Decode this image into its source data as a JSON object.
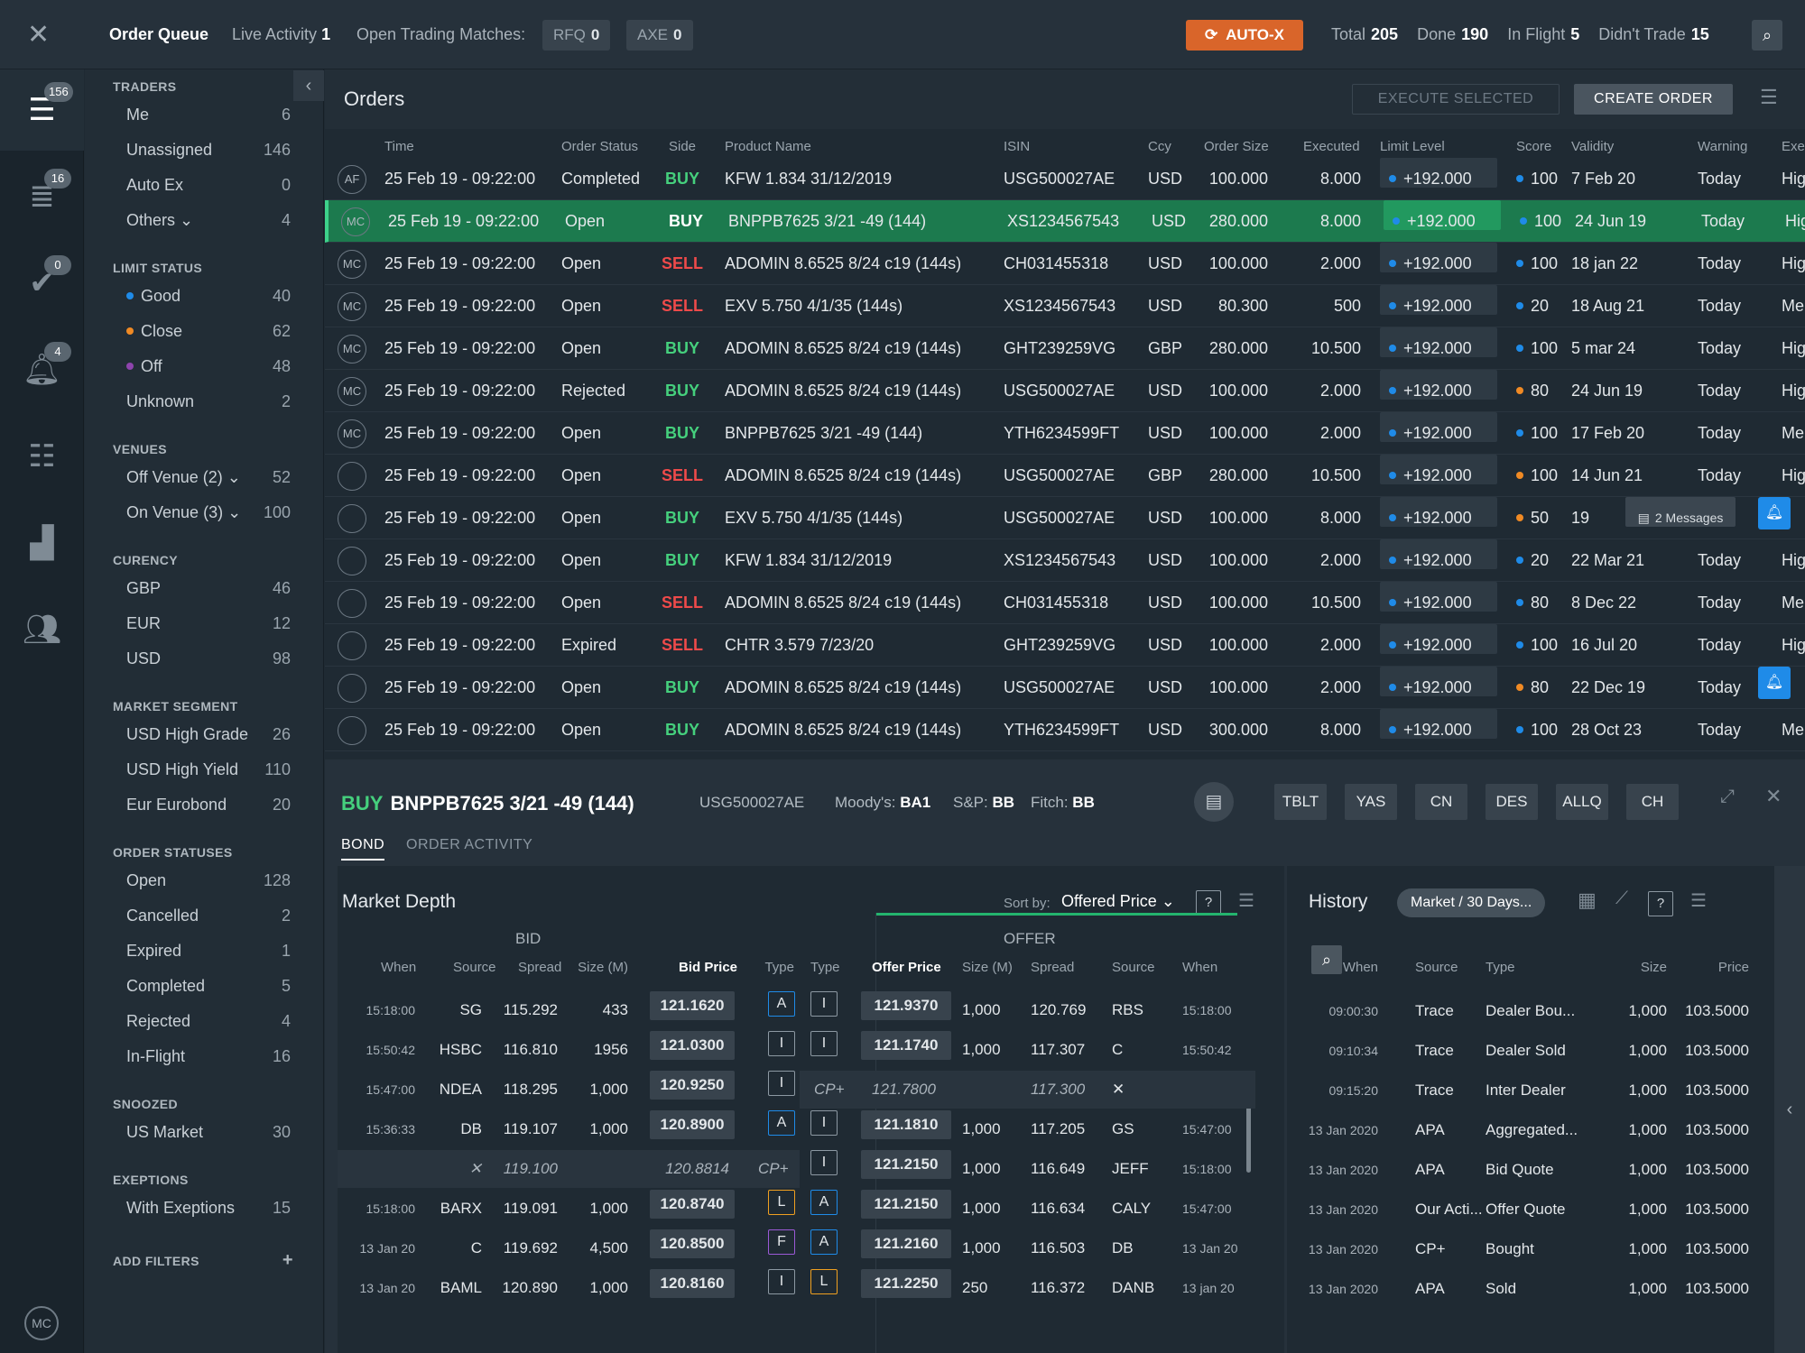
{
  "topbar": {
    "order_queue": "Order Queue",
    "live_activity_label": "Live Activity",
    "live_activity_count": "1",
    "open_matches_label": "Open Trading Matches:",
    "rfq_label": "RFQ",
    "rfq_count": "0",
    "axe_label": "AXE",
    "axe_count": "0",
    "autox": "AUTO-X",
    "total_label": "Total",
    "total": "205",
    "done_label": "Done",
    "done": "190",
    "inflight_label": "In Flight",
    "inflight": "5",
    "didnt_label": "Didn't Trade",
    "didnt": "15"
  },
  "leftnav": {
    "badges": [
      "156",
      "16",
      "0",
      "4"
    ],
    "avatar": "MC"
  },
  "filters": {
    "sections": [
      {
        "title": "TRADERS",
        "items": [
          {
            "label": "Me",
            "count": "6"
          },
          {
            "label": "Unassigned",
            "count": "146"
          },
          {
            "label": "Auto Ex",
            "count": "0"
          },
          {
            "label": "Others ⌄",
            "count": "4"
          }
        ]
      },
      {
        "title": "LIMIT STATUS",
        "items": [
          {
            "label": "Good",
            "count": "40",
            "dot": "#1f8be8"
          },
          {
            "label": "Close",
            "count": "62",
            "dot": "#f08a24"
          },
          {
            "label": "Off",
            "count": "48",
            "dot": "#8e44ad"
          },
          {
            "label": "Unknown",
            "count": "2"
          }
        ]
      },
      {
        "title": "VENUES",
        "items": [
          {
            "label": "Off Venue (2) ⌄",
            "count": "52"
          },
          {
            "label": "On Venue (3) ⌄",
            "count": "100"
          }
        ]
      },
      {
        "title": "CURENCY",
        "items": [
          {
            "label": "GBP",
            "count": "46"
          },
          {
            "label": "EUR",
            "count": "12"
          },
          {
            "label": "USD",
            "count": "98"
          }
        ]
      },
      {
        "title": "MARKET SEGMENT",
        "items": [
          {
            "label": "USD High Grade",
            "count": "26"
          },
          {
            "label": "USD High Yield",
            "count": "110"
          },
          {
            "label": "Eur Eurobond",
            "count": "20"
          }
        ]
      },
      {
        "title": "ORDER STATUSES",
        "items": [
          {
            "label": "Open",
            "count": "128"
          },
          {
            "label": "Cancelled",
            "count": "2"
          },
          {
            "label": "Expired",
            "count": "1"
          },
          {
            "label": "Completed",
            "count": "5"
          },
          {
            "label": "Rejected",
            "count": "4"
          },
          {
            "label": "In-Flight",
            "count": "16"
          }
        ]
      },
      {
        "title": "SNOOZED",
        "items": [
          {
            "label": "US Market",
            "count": "30"
          }
        ]
      },
      {
        "title": "EXEPTIONS",
        "items": [
          {
            "label": "With Exeptions",
            "count": "15"
          }
        ]
      }
    ],
    "add_filters": "ADD FILTERS"
  },
  "orders": {
    "title": "Orders",
    "execute_selected": "EXECUTE SELECTED",
    "create_order": "CREATE ORDER",
    "columns": [
      "Time",
      "Order Status",
      "Side",
      "Product Name",
      "ISIN",
      "Ccy",
      "Order Size",
      "Executed",
      "Limit Level",
      "Score",
      "Validity",
      "Warning",
      "Exe"
    ],
    "rows": [
      {
        "mark": "AF",
        "time": "25 Feb 19 - 09:22:00",
        "status": "Completed",
        "side": "BUY",
        "product": "KFW  1.834  31/12/2019",
        "isin": "USG500027AE",
        "ccy": "USD",
        "size": "100.000",
        "executed": "8.000",
        "limit": "+192.000",
        "score": "100",
        "score_color": "#1f8be8",
        "validity": "7 Feb 20",
        "warning": "Today",
        "exe": "Hig"
      },
      {
        "mark": "MC",
        "time": "25 Feb 19 - 09:22:00",
        "status": "Open",
        "side": "BUY",
        "product": "BNPPB7625  3/21  -49 (144)",
        "isin": "XS1234567543",
        "ccy": "USD",
        "size": "280.000",
        "executed": "8.000",
        "limit": "+192.000",
        "score": "100",
        "score_color": "#1f8be8",
        "validity": "24 Jun 19",
        "warning": "Today",
        "exe": "Hig",
        "selected": true
      },
      {
        "mark": "MC",
        "time": "25 Feb 19 - 09:22:00",
        "status": "Open",
        "side": "SELL",
        "product": "ADOMIN  8.6525  8/24  c19 (144s)",
        "isin": "CH031455318",
        "ccy": "USD",
        "size": "100.000",
        "executed": "2.000",
        "limit": "+192.000",
        "score": "100",
        "score_color": "#1f8be8",
        "validity": "18 jan 22",
        "warning": "Today",
        "exe": "Hig"
      },
      {
        "mark": "MC",
        "time": "25 Feb 19 - 09:22:00",
        "status": "Open",
        "side": "SELL",
        "product": "EXV  5.750  4/1/35  (144s)",
        "isin": "XS1234567543",
        "ccy": "USD",
        "size": "80.300",
        "executed": "500",
        "limit": "+192.000",
        "score": "20",
        "score_color": "#1f8be8",
        "validity": "18 Aug 21",
        "warning": "Today",
        "exe": "Me"
      },
      {
        "mark": "MC",
        "time": "25 Feb 19 - 09:22:00",
        "status": "Open",
        "side": "BUY",
        "product": "ADOMIN  8.6525  8/24  c19 (144s)",
        "isin": "GHT239259VG",
        "ccy": "GBP",
        "size": "280.000",
        "executed": "10.500",
        "limit": "+192.000",
        "score": "100",
        "score_color": "#1f8be8",
        "validity": "5 mar 24",
        "warning": "Today",
        "exe": "Hig"
      },
      {
        "mark": "MC",
        "time": "25 Feb 19 - 09:22:00",
        "status": "Rejected",
        "side": "BUY",
        "product": "ADOMIN  8.6525  8/24  c19 (144s)",
        "isin": "USG500027AE",
        "ccy": "USD",
        "size": "100.000",
        "executed": "2.000",
        "limit": "+192.000",
        "score": "80",
        "score_color": "#f08a24",
        "validity": "24 Jun 19",
        "warning": "Today",
        "exe": "Hig"
      },
      {
        "mark": "MC",
        "time": "25 Feb 19 - 09:22:00",
        "status": "Open",
        "side": "BUY",
        "product": "BNPPB7625  3/21  -49 (144)",
        "isin": "YTH6234599FT",
        "ccy": "USD",
        "size": "100.000",
        "executed": "2.000",
        "limit": "+192.000",
        "score": "100",
        "score_color": "#1f8be8",
        "validity": "17 Feb 20",
        "warning": "Today",
        "exe": "Me"
      },
      {
        "mark": "",
        "time": "25 Feb 19 - 09:22:00",
        "status": "Open",
        "side": "SELL",
        "product": "ADOMIN  8.6525  8/24  c19 (144s)",
        "isin": "USG500027AE",
        "ccy": "GBP",
        "size": "280.000",
        "executed": "10.500",
        "limit": "+192.000",
        "score": "100",
        "score_color": "#f08a24",
        "validity": "14 Jun 21",
        "warning": "Today",
        "exe": "Hig"
      },
      {
        "mark": "",
        "time": "25 Feb 19 - 09:22:00",
        "status": "Open",
        "side": "BUY",
        "product": "EXV  5.750  4/1/35  (144s)",
        "isin": "USG500027AE",
        "ccy": "USD",
        "size": "100.000",
        "executed": "8.000",
        "limit": "+192.000",
        "score": "50",
        "score_color": "#f08a24",
        "validity": "19",
        "warning": "",
        "exe": "",
        "messages": "2 Messages",
        "bell": true
      },
      {
        "mark": "",
        "time": "25 Feb 19 - 09:22:00",
        "status": "Open",
        "side": "BUY",
        "product": "KFW  1.834  31/12/2019",
        "isin": "XS1234567543",
        "ccy": "USD",
        "size": "100.000",
        "executed": "2.000",
        "limit": "+192.000",
        "score": "20",
        "score_color": "#1f8be8",
        "validity": "22 Mar 21",
        "warning": "Today",
        "exe": "Hig"
      },
      {
        "mark": "",
        "time": "25 Feb 19 - 09:22:00",
        "status": "Open",
        "side": "SELL",
        "product": "ADOMIN  8.6525  8/24  c19 (144s)",
        "isin": "CH031455318",
        "ccy": "USD",
        "size": "100.000",
        "executed": "10.500",
        "limit": "+192.000",
        "score": "80",
        "score_color": "#1f8be8",
        "validity": "8 Dec 22",
        "warning": "Today",
        "exe": "Me"
      },
      {
        "mark": "",
        "time": "25 Feb 19 - 09:22:00",
        "status": "Expired",
        "side": "SELL",
        "product": "CHTR  3.579  7/23/20",
        "isin": "GHT239259VG",
        "ccy": "USD",
        "size": "100.000",
        "executed": "2.000",
        "limit": "+192.000",
        "score": "100",
        "score_color": "#1f8be8",
        "validity": "16 Jul 20",
        "warning": "Today",
        "exe": "Hig"
      },
      {
        "mark": "",
        "time": "25 Feb 19 - 09:22:00",
        "status": "Open",
        "side": "BUY",
        "product": "ADOMIN  8.6525  8/24  c19 (144s)",
        "isin": "USG500027AE",
        "ccy": "USD",
        "size": "100.000",
        "executed": "2.000",
        "limit": "+192.000",
        "score": "80",
        "score_color": "#f08a24",
        "validity": "22 Dec 19",
        "warning": "Today",
        "exe": "",
        "bell": true
      },
      {
        "mark": "",
        "time": "25 Feb 19 - 09:22:00",
        "status": "Open",
        "side": "BUY",
        "product": "ADOMIN  8.6525  8/24  c19 (144s)",
        "isin": "YTH6234599FT",
        "ccy": "USD",
        "size": "300.000",
        "executed": "8.000",
        "limit": "+192.000",
        "score": "100",
        "score_color": "#1f8be8",
        "validity": "28 Oct 23",
        "warning": "Today",
        "exe": "Me"
      }
    ]
  },
  "detail": {
    "side": "BUY",
    "product": "BNPPB7625  3/21 -49 (144)",
    "isin": "USG500027AE",
    "moodys_label": "Moody's:",
    "moodys": "BA1",
    "sp_label": "S&P:",
    "sp": "BB",
    "fitch_label": "Fitch:",
    "fitch": "BB",
    "buttons": [
      "TBLT",
      "YAS",
      "CN",
      "DES",
      "ALLQ",
      "CH"
    ],
    "tabs": [
      "BOND",
      "ORDER ACTIVITY"
    ],
    "market_depth": {
      "title": "Market Depth",
      "sort_label": "Sort by:",
      "sort_value": "Offered Price",
      "bid_label": "BID",
      "offer_label": "OFFER",
      "bid_cols": [
        "When",
        "Source",
        "Spread",
        "Size (M)",
        "Bid Price",
        "Type"
      ],
      "offer_cols": [
        "Type",
        "Offer Price",
        "Size (M)",
        "Spread",
        "Source",
        "When"
      ],
      "rows": [
        {
          "bw": "15:18:00",
          "bs": "SG",
          "bsp": "115.292",
          "bsz": "433",
          "bp": "121.1620",
          "bt": "A",
          "ot": "I",
          "op": "121.9370",
          "osz": "1,000",
          "osp": "120.769",
          "os": "RBS",
          "ow": "15:18:00"
        },
        {
          "bw": "15:50:42",
          "bs": "HSBC",
          "bsp": "116.810",
          "bsz": "1956",
          "bp": "121.0300",
          "bt": "I",
          "ot": "I",
          "op": "121.1740",
          "osz": "1,000",
          "osp": "117.307",
          "os": "C",
          "ow": "15:50:42"
        },
        {
          "bw": "15:47:00",
          "bs": "NDEA",
          "bsp": "118.295",
          "bsz": "1,000",
          "bp": "120.9250",
          "bt": "I",
          "ot": "CP+",
          "op": "121.7800",
          "osz": "",
          "osp": "117.300",
          "os": "✕",
          "ow": "",
          "omid": true
        },
        {
          "bw": "15:36:33",
          "bs": "DB",
          "bsp": "119.107",
          "bsz": "1,000",
          "bp": "120.8900",
          "bt": "A",
          "ot": "I",
          "op": "121.1810",
          "osz": "1,000",
          "osp": "117.205",
          "os": "GS",
          "ow": "15:47:00"
        },
        {
          "bw": "",
          "bs": "✕",
          "bsp": "119.100",
          "bsz": "",
          "bp": "120.8814",
          "bt": "CP+",
          "bmid": true,
          "ot": "I",
          "op": "121.2150",
          "osz": "1,000",
          "osp": "116.649",
          "os": "JEFF",
          "ow": "15:18:00"
        },
        {
          "bw": "15:18:00",
          "bs": "BARX",
          "bsp": "119.091",
          "bsz": "1,000",
          "bp": "120.8740",
          "bt": "L",
          "ot": "A",
          "op": "121.2150",
          "osz": "1,000",
          "osp": "116.634",
          "os": "CALY",
          "ow": "15:47:00"
        },
        {
          "bw": "13 Jan 20",
          "bs": "C",
          "bsp": "119.692",
          "bsz": "4,500",
          "bp": "120.8500",
          "bt": "F",
          "ot": "A",
          "op": "121.2160",
          "osz": "1,000",
          "osp": "116.503",
          "os": "DB",
          "ow": "13 Jan 20"
        },
        {
          "bw": "13 Jan 20",
          "bs": "BAML",
          "bsp": "120.890",
          "bsz": "1,000",
          "bp": "120.8160",
          "bt": "I",
          "ot": "L",
          "op": "121.2250",
          "osz": "250",
          "osp": "116.372",
          "os": "DANB",
          "ow": "13 jan 20"
        }
      ]
    },
    "history": {
      "title": "History",
      "filter": "Market / 30 Days...",
      "cols": [
        "When",
        "Source",
        "Type",
        "Size",
        "Price"
      ],
      "rows": [
        {
          "when": "09:00:30",
          "source": "Trace",
          "type": "Dealer Bou...",
          "size": "1,000",
          "price": "103.5000"
        },
        {
          "when": "09:10:34",
          "source": "Trace",
          "type": "Dealer Sold",
          "size": "1,000",
          "price": "103.5000"
        },
        {
          "when": "09:15:20",
          "source": "Trace",
          "type": "Inter Dealer",
          "size": "1,000",
          "price": "103.5000"
        },
        {
          "when": "13 Jan 2020",
          "source": "APA",
          "type": "Aggregated...",
          "size": "1,000",
          "price": "103.5000"
        },
        {
          "when": "13 Jan 2020",
          "source": "APA",
          "type": "Bid Quote",
          "size": "1,000",
          "price": "103.5000"
        },
        {
          "when": "13 Jan 2020",
          "source": "Our Acti...",
          "type": "Offer Quote",
          "size": "1,000",
          "price": "103.5000"
        },
        {
          "when": "13 Jan 2020",
          "source": "CP+",
          "type": "Bought",
          "size": "1,000",
          "price": "103.5000"
        },
        {
          "when": "13 Jan 2020",
          "source": "APA",
          "type": "Sold",
          "size": "1,000",
          "price": "103.5000"
        }
      ]
    }
  },
  "colors": {
    "buy": "#45d07d",
    "sell": "#ef4a4a",
    "accent": "#d9652a",
    "selected_row": "#1c7a4e",
    "good": "#1f8be8",
    "close": "#f08a24",
    "off": "#8e44ad"
  }
}
